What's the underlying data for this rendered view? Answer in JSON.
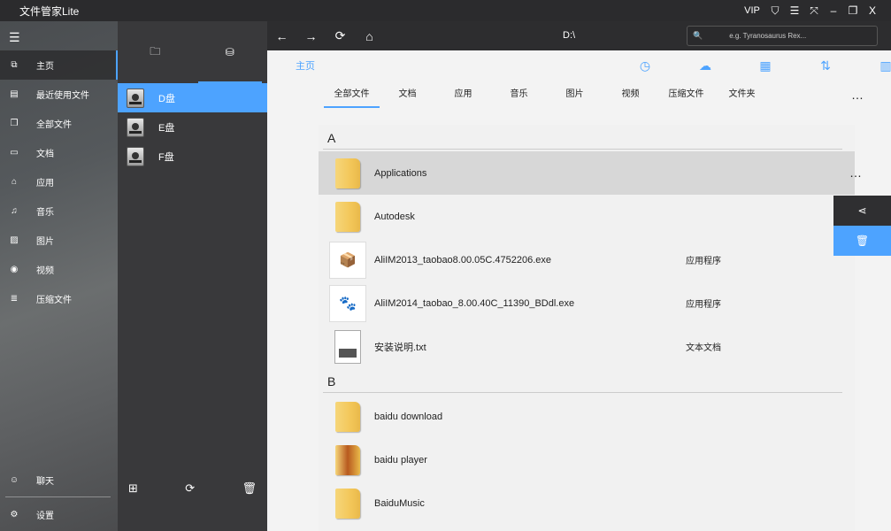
{
  "app": {
    "title": "文件管家Lite"
  },
  "window": {
    "vip": "VIP",
    "skin_icon": "shirt-icon",
    "menu_icon": "menu-icon",
    "shrink_icon": "compress-icon",
    "min_icon": "minimize-icon",
    "restore_icon": "restore-icon",
    "close": "X"
  },
  "sidebar": {
    "items": [
      {
        "label": "主页",
        "icon": "home-icon",
        "glyph": "⧉"
      },
      {
        "label": "最近使用文件",
        "icon": "recent-icon",
        "glyph": "▤"
      },
      {
        "label": "全部文件",
        "icon": "all-files-icon",
        "glyph": "❐"
      },
      {
        "label": "文档",
        "icon": "document-icon",
        "glyph": "▭"
      },
      {
        "label": "应用",
        "icon": "app-icon",
        "glyph": "⌂"
      },
      {
        "label": "音乐",
        "icon": "music-icon",
        "glyph": "♫"
      },
      {
        "label": "图片",
        "icon": "picture-icon",
        "glyph": "▨"
      },
      {
        "label": "视频",
        "icon": "video-icon",
        "glyph": "◉"
      },
      {
        "label": "压缩文件",
        "icon": "archive-icon",
        "glyph": "≣"
      }
    ],
    "bottom": [
      {
        "label": "聊天",
        "icon": "chat-icon",
        "glyph": "☺"
      },
      {
        "label": "设置",
        "icon": "settings-icon",
        "glyph": "⚙"
      }
    ]
  },
  "drives": {
    "items": [
      {
        "label": "D盘"
      },
      {
        "label": "E盘"
      },
      {
        "label": "F盘"
      }
    ]
  },
  "toolbar": {
    "path": "D:\\",
    "search_placeholder": "e.g. Tyranosaurus Rex..."
  },
  "main": {
    "crumb": "主页",
    "tabs": [
      "全部文件",
      "文档",
      "应用",
      "音乐",
      "图片",
      "视频",
      "压缩文件",
      "文件夹"
    ],
    "more": "…",
    "groups": [
      {
        "letter": "A",
        "files": [
          {
            "name": "Applications",
            "type": ""
          },
          {
            "name": "Autodesk",
            "type": ""
          },
          {
            "name": "AliIM2013_taobao8.00.05C.4752206.exe",
            "type": "应用程序"
          },
          {
            "name": "AliIM2014_taobao_8.00.40C_11390_BDdl.exe",
            "type": "应用程序"
          },
          {
            "name": "安装说明.txt",
            "type": "文本文档"
          }
        ]
      },
      {
        "letter": "B",
        "files": [
          {
            "name": "baidu download",
            "type": ""
          },
          {
            "name": "baidu player",
            "type": ""
          },
          {
            "name": "BaiduMusic",
            "type": ""
          }
        ]
      }
    ]
  },
  "colors": {
    "accent": "#4da3ff",
    "dark": "#2d2d2f"
  }
}
